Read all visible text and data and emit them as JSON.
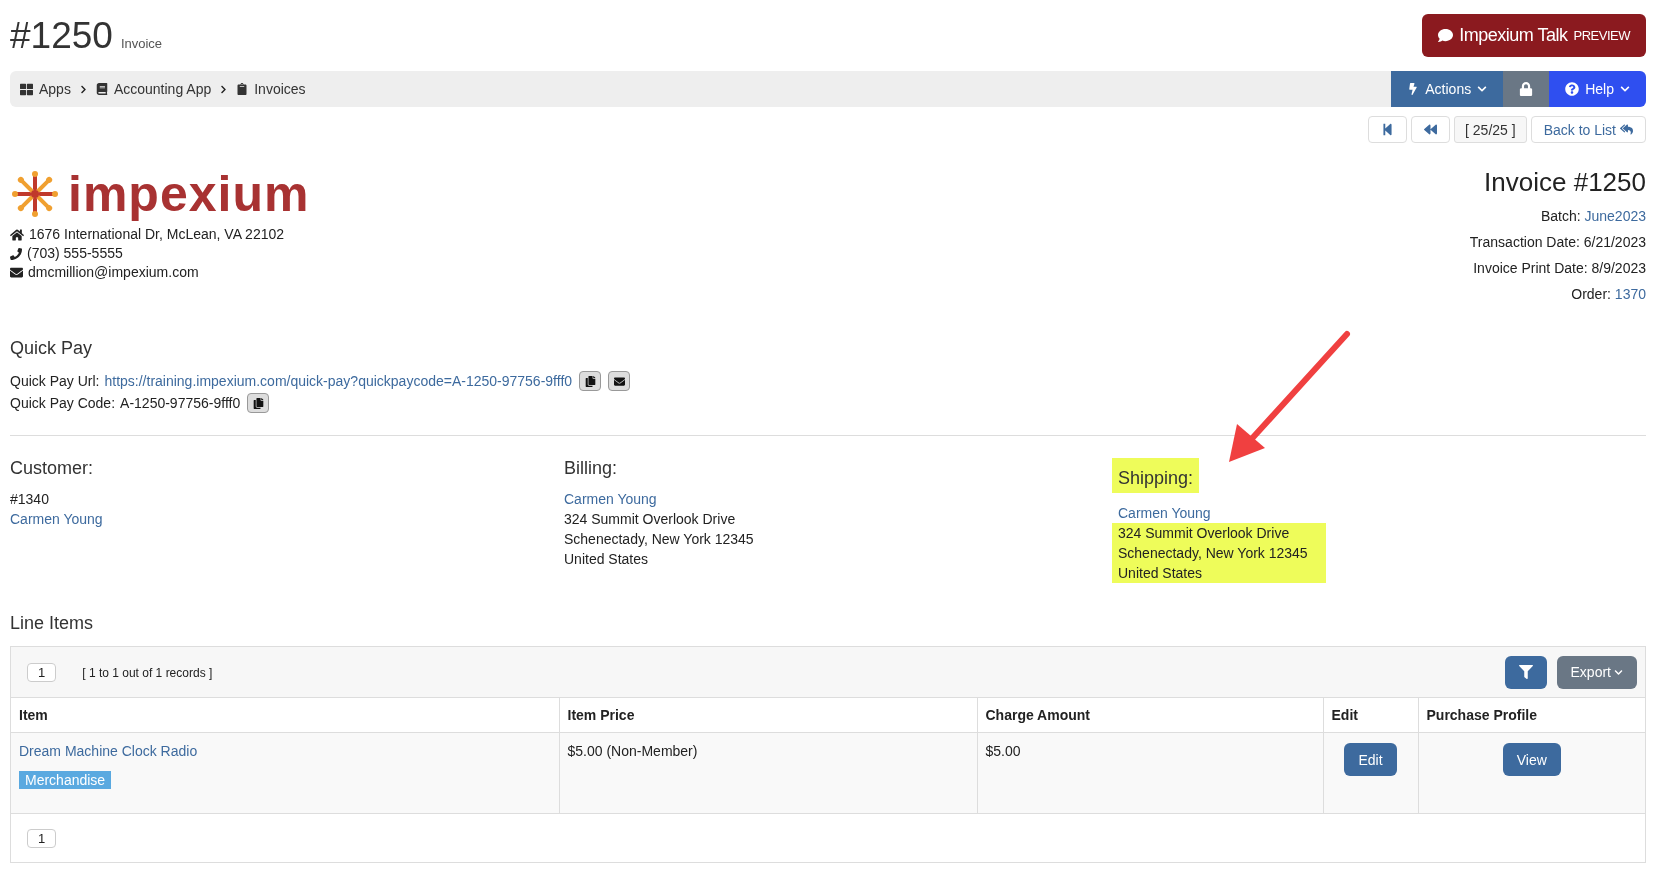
{
  "header": {
    "number": "#1250",
    "subtitle": "Invoice",
    "talk_button": {
      "label": "Impexium Talk",
      "badge": "PREVIEW"
    }
  },
  "breadcrumb": [
    {
      "label": "Apps",
      "kind": "apps"
    },
    {
      "label": "Accounting App",
      "kind": "book"
    },
    {
      "label": "Invoices",
      "kind": "clipboard"
    }
  ],
  "toolbar": {
    "actions": "Actions",
    "help": "Help"
  },
  "record_nav": {
    "position": "[ 25/25 ]",
    "back": "Back to List"
  },
  "company": {
    "logo_text": "impexium",
    "address": "1676 International Dr, McLean, VA 22102",
    "phone": "(703) 555-5555",
    "email": "dmcmillion@impexium.com"
  },
  "invoice": {
    "title": "Invoice #1250",
    "fields": [
      {
        "label": "Batch:",
        "value": "June2023",
        "link": true
      },
      {
        "label": "Transaction Date:",
        "value": "6/21/2023",
        "link": false
      },
      {
        "label": "Invoice Print Date:",
        "value": "8/9/2023",
        "link": false
      },
      {
        "label": "Order:",
        "value": "1370",
        "link": true
      }
    ]
  },
  "quick_pay": {
    "heading": "Quick Pay",
    "url_label": "Quick Pay Url:",
    "url": "https://training.impexium.com/quick-pay?quickpaycode=A-1250-97756-9fff0",
    "code_label": "Quick Pay Code:",
    "code": "A-1250-97756-9fff0"
  },
  "parties": [
    {
      "heading": "Customer:",
      "highlighted": false,
      "lines": [
        {
          "text": "#1340",
          "link": false,
          "highlighted": false
        },
        {
          "text": "Carmen Young",
          "link": true,
          "highlighted": false
        }
      ]
    },
    {
      "heading": "Billing:",
      "highlighted": false,
      "lines": [
        {
          "text": "Carmen Young",
          "link": true,
          "highlighted": false
        },
        {
          "text": "324 Summit Overlook Drive",
          "link": false,
          "highlighted": false
        },
        {
          "text": "Schenectady, New York 12345",
          "link": false,
          "highlighted": false
        },
        {
          "text": "United States",
          "link": false,
          "highlighted": false
        }
      ]
    },
    {
      "heading": "Shipping:",
      "highlighted": true,
      "lines": [
        {
          "text": "Carmen Young",
          "link": true,
          "highlighted": false
        },
        {
          "text": "324 Summit Overlook Drive",
          "link": false,
          "highlighted": true
        },
        {
          "text": "Schenectady, New York 12345",
          "link": false,
          "highlighted": true
        },
        {
          "text": "United States",
          "link": false,
          "highlighted": true
        }
      ]
    }
  ],
  "line_items": {
    "heading": "Line Items",
    "page": "1",
    "records": "[ 1 to 1 out of 1 records ]",
    "export": "Export",
    "footer_page": "1",
    "columns": [
      "Item",
      "Item Price",
      "Charge Amount",
      "Edit",
      "Purchase Profile"
    ],
    "rows": [
      {
        "item": "Dream Machine Clock Radio",
        "tag": "Merchandise",
        "price": "$5.00 (Non-Member)",
        "charge": "$5.00",
        "edit": "Edit",
        "profile": "View"
      }
    ]
  }
}
